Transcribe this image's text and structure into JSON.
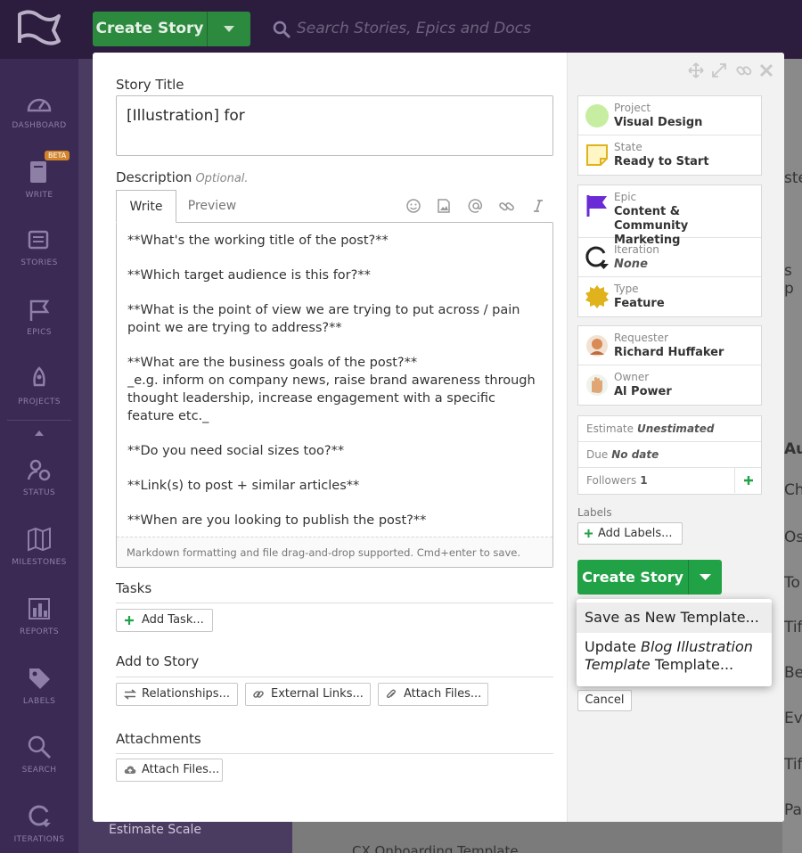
{
  "topbar": {
    "create_label": "Create Story",
    "search_placeholder": "Search Stories, Epics and Docs"
  },
  "sidebar": {
    "items": [
      {
        "label": "DASHBOARD",
        "icon": "dashboard-icon"
      },
      {
        "label": "WRITE",
        "icon": "write-icon",
        "badge": "BETA"
      },
      {
        "label": "STORIES",
        "icon": "stories-icon"
      },
      {
        "label": "EPICS",
        "icon": "epics-icon"
      },
      {
        "label": "PROJECTS",
        "icon": "projects-icon"
      },
      {
        "label": "STATUS",
        "icon": "status-icon"
      },
      {
        "label": "MILESTONES",
        "icon": "milestones-icon"
      },
      {
        "label": "REPORTS",
        "icon": "reports-icon"
      },
      {
        "label": "LABELS",
        "icon": "labels-icon"
      },
      {
        "label": "SEARCH",
        "icon": "search-icon"
      },
      {
        "label": "ITERATIONS",
        "icon": "iterations-icon"
      }
    ]
  },
  "background": {
    "estimate_scale": "Estimate Scale",
    "right_cells": [
      "ste",
      "s p",
      "Au",
      "Ch",
      "Os",
      "To",
      "Tif",
      "Be",
      "Ev",
      "Tif",
      "Pa"
    ],
    "bottom_text": "CX Onboarding Template"
  },
  "modal": {
    "title_label": "Story Title",
    "title_value": "[Illustration] for",
    "description_label": "Description",
    "description_optional": "Optional.",
    "tab_write": "Write",
    "tab_preview": "Preview",
    "description_lines": [
      "**What's the working title of the post?**",
      "**Which target audience is this for?**",
      "**What is the point of view we are trying to put across / pain point we are trying to address?**",
      "**What are the business goals of the post?**\n_e.g. inform on company news, raise brand awareness through thought leadership, increase engagement with a specific feature etc._",
      "**Do you need social sizes too?**",
      "**Link(s) to post + similar articles**",
      "**When are you looking to publish the post?**"
    ],
    "markdown_hint": "Markdown formatting and file drag-and-drop supported. Cmd+enter to save.",
    "tasks_label": "Tasks",
    "add_task": "Add Task...",
    "add_to_story_label": "Add to Story",
    "relationships": "Relationships...",
    "external_links": "External Links...",
    "attach_files": "Attach Files...",
    "attachments_label": "Attachments",
    "attach_files_2": "Attach Files..."
  },
  "details": {
    "project_key": "Project",
    "project_value": "Visual Design",
    "state_key": "State",
    "state_value": "Ready to Start",
    "epic_key": "Epic",
    "epic_value": "Content & Community Marketing",
    "iteration_key": "Iteration",
    "iteration_value": "None",
    "type_key": "Type",
    "type_value": "Feature",
    "requester_key": "Requester",
    "requester_value": "Richard Huffaker",
    "owner_key": "Owner",
    "owner_value": "Al Power",
    "estimate_key": "Estimate",
    "estimate_value": "Unestimated",
    "due_key": "Due",
    "due_value": "No date",
    "followers_key": "Followers",
    "followers_value": "1",
    "labels_label": "Labels",
    "add_labels": "Add Labels...",
    "create_story": "Create Story",
    "cancel": "Cancel"
  },
  "template_menu": {
    "save_new": "Save as New Template...",
    "update_prefix": "Update",
    "update_name_1": "Blog Illustration",
    "update_name_2": "Template",
    "update_suffix": "Template..."
  },
  "colors": {
    "topbar": "#2c1d3f",
    "sidebar": "#3a2a54",
    "create_green": "#22a246",
    "project_dot": "#c6eda0",
    "state_yellow": "#fff6c6",
    "epic_purple": "#6a2bd6",
    "feature_gold": "#e0b21b"
  }
}
